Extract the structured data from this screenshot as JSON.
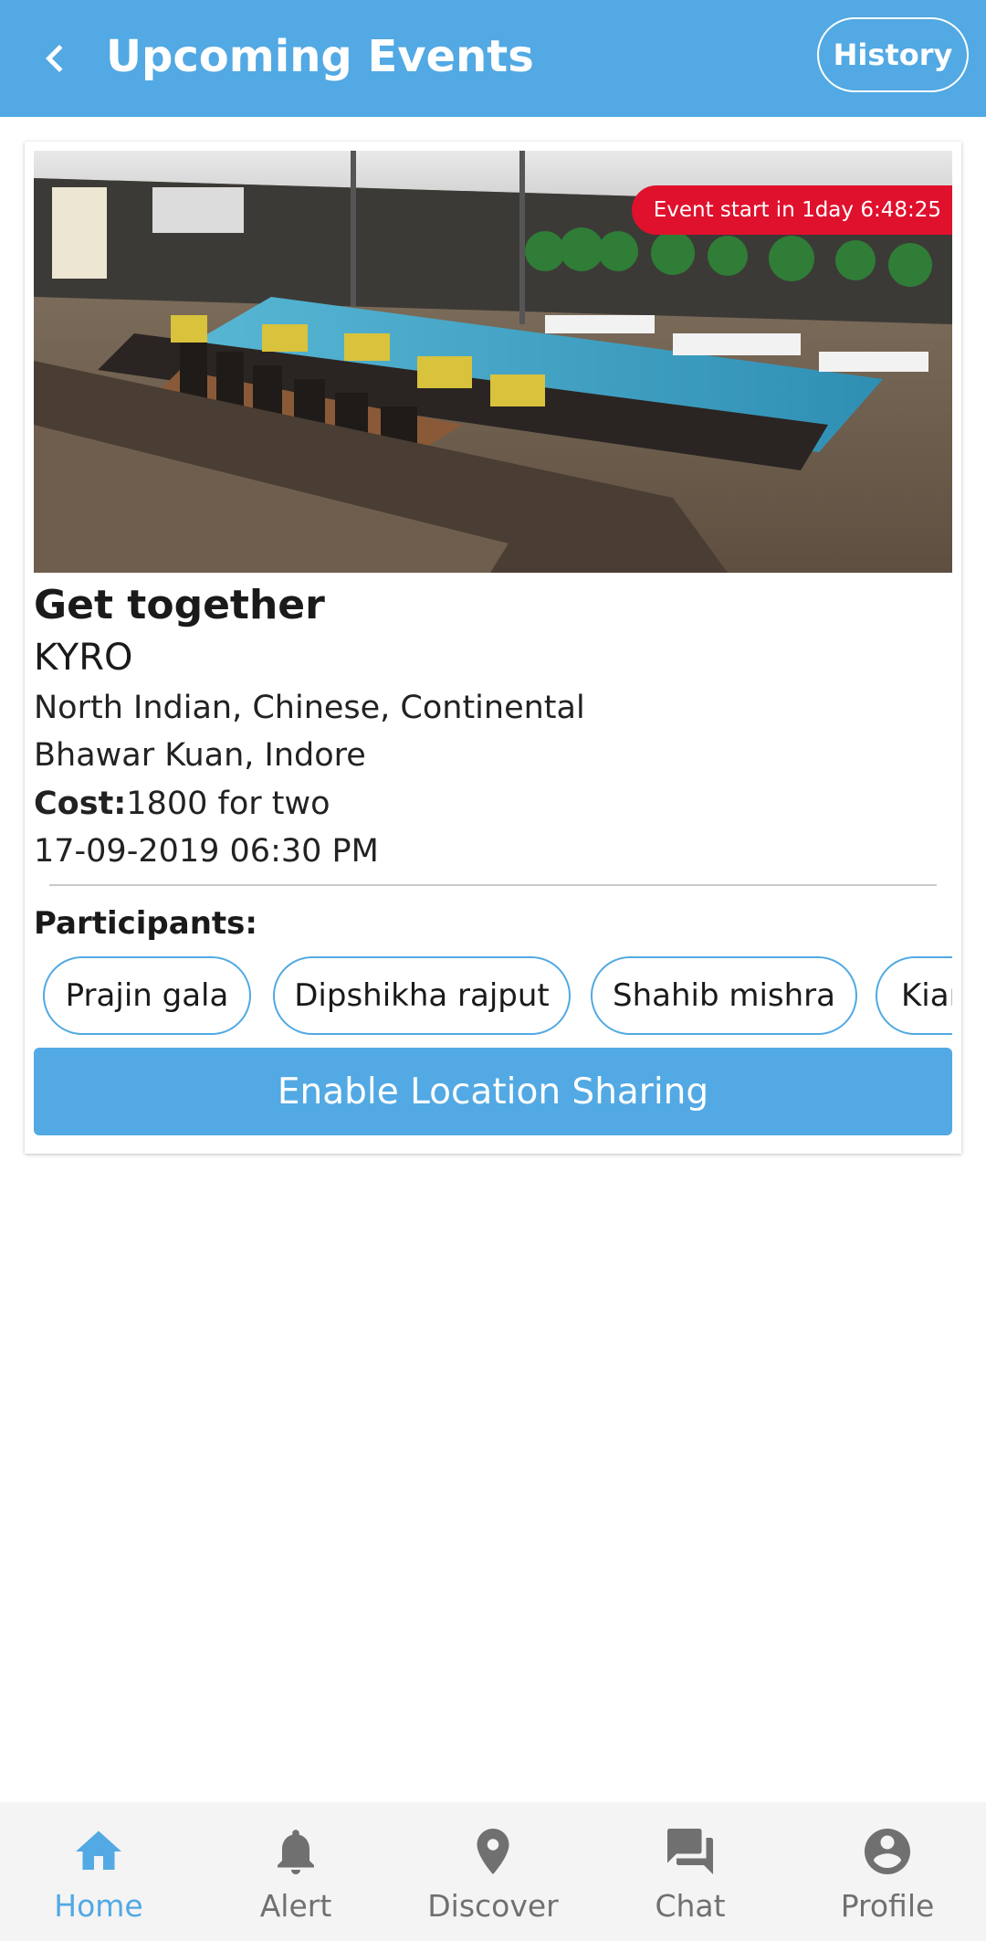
{
  "header": {
    "title": "Upcoming Events",
    "history_label": "History"
  },
  "event": {
    "countdown": "Event start in 1day 6:48:25",
    "name": "Get together",
    "venue": "KYRO",
    "cuisine": "North Indian, Chinese, Continental",
    "address": "Bhawar Kuan, Indore",
    "cost_label": "Cost:",
    "cost_value": "1800 for two",
    "datetime": "17-09-2019 06:30 PM",
    "participants_label": "Participants:",
    "participants": [
      "Prajin gala",
      "Dipshikha rajput",
      "Shahib mishra",
      "Kiar"
    ],
    "location_button": "Enable Location Sharing"
  },
  "nav": {
    "items": [
      {
        "label": "Home",
        "icon": "home-icon",
        "active": true
      },
      {
        "label": "Alert",
        "icon": "bell-icon",
        "active": false
      },
      {
        "label": "Discover",
        "icon": "location-pin-icon",
        "active": false
      },
      {
        "label": "Chat",
        "icon": "chat-icon",
        "active": false
      },
      {
        "label": "Profile",
        "icon": "account-circle-icon",
        "active": false
      }
    ]
  },
  "colors": {
    "primary": "#52a9e3",
    "timer": "#e0112d",
    "inactive": "#707070"
  }
}
